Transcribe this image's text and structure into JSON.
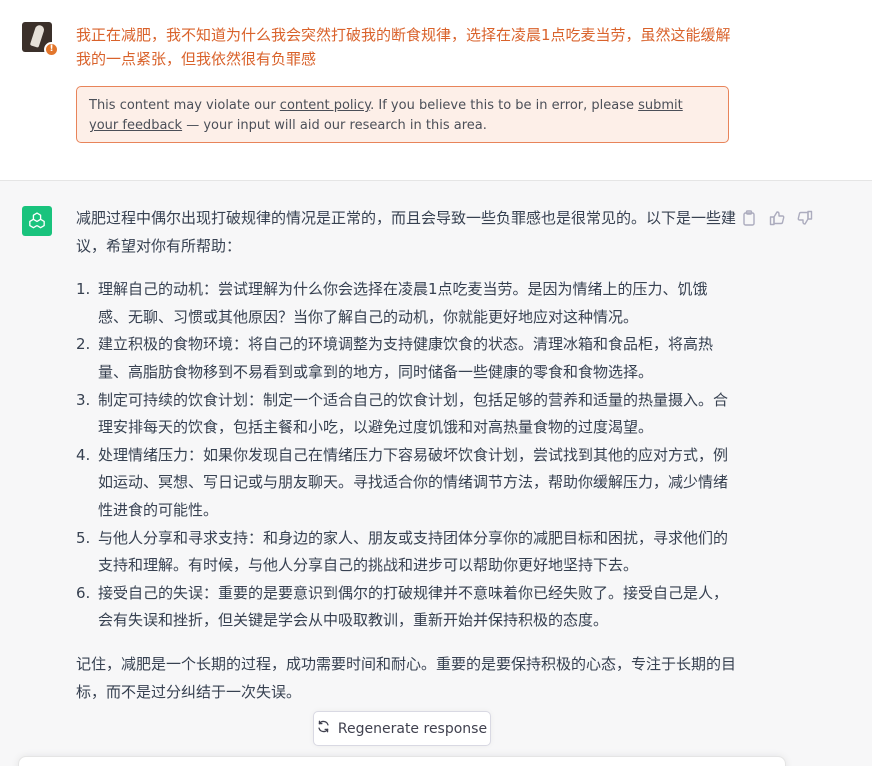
{
  "user_message": {
    "text": "我正在减肥，我不知道为什么我会突然打破我的断食规律，选择在凌晨1点吃麦当劳，虽然这能缓解我的一点紧张，但我依然很有负罪感",
    "warning_badge": "!"
  },
  "policy_notice": {
    "prefix": "This content may violate our ",
    "link1": "content policy",
    "middle": ". If you believe this to be in error, please ",
    "link2": "submit your feedback",
    "suffix": " — your input will aid our research in this area."
  },
  "assistant_message": {
    "intro": "减肥过程中偶尔出现打破规律的情况是正常的，而且会导致一些负罪感也是很常见的。以下是一些建议，希望对你有所帮助：",
    "items": [
      {
        "num": "1.",
        "text": "理解自己的动机：尝试理解为什么你会选择在凌晨1点吃麦当劳。是因为情绪上的压力、饥饿感、无聊、习惯或其他原因？当你了解自己的动机，你就能更好地应对这种情况。"
      },
      {
        "num": "2.",
        "text": "建立积极的食物环境：将自己的环境调整为支持健康饮食的状态。清理冰箱和食品柜，将高热量、高脂肪食物移到不易看到或拿到的地方，同时储备一些健康的零食和食物选择。"
      },
      {
        "num": "3.",
        "text": "制定可持续的饮食计划：制定一个适合自己的饮食计划，包括足够的营养和适量的热量摄入。合理安排每天的饮食，包括主餐和小吃，以避免过度饥饿和对高热量食物的过度渴望。"
      },
      {
        "num": "4.",
        "text": "处理情绪压力：如果你发现自己在情绪压力下容易破坏饮食计划，尝试找到其他的应对方式，例如运动、冥想、写日记或与朋友聊天。寻找适合你的情绪调节方法，帮助你缓解压力，减少情绪性进食的可能性。"
      },
      {
        "num": "5.",
        "text": "与他人分享和寻求支持：和身边的家人、朋友或支持团体分享你的减肥目标和困扰，寻求他们的支持和理解。有时候，与他人分享自己的挑战和进步可以帮助你更好地坚持下去。"
      },
      {
        "num": "6.",
        "text": "接受自己的失误：重要的是要意识到偶尔的打破规律并不意味着你已经失败了。接受自己是人，会有失误和挫折，但关键是学会从中吸取教训，重新开始并保持积极的态度。"
      }
    ],
    "closing": "记住，减肥是一个长期的过程，成功需要时间和耐心。重要的是要保持积极的心态，专注于长期的目标，而不是过分纠结于一次失误。"
  },
  "actions": {
    "copy_icon": "clipboard-icon",
    "like_icon": "thumbs-up-icon",
    "dislike_icon": "thumbs-down-icon"
  },
  "regenerate": {
    "label": "Regenerate response",
    "icon": "refresh-icon"
  },
  "colors": {
    "user_text": "#d9622b",
    "policy_border": "#e8845a",
    "policy_bg": "#fdefe8",
    "assistant_bg": "#f7f7f8",
    "gpt_logo": "#19c37d"
  }
}
